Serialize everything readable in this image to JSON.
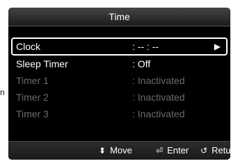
{
  "side_text": "n",
  "dialog": {
    "title": "Time"
  },
  "menu": {
    "items": [
      {
        "label": "Clock",
        "value": ": -- : --",
        "state": "highlighted"
      },
      {
        "label": "Sleep Timer",
        "value": ": Off",
        "state": "active"
      },
      {
        "label": "Timer 1",
        "value": ": Inactivated",
        "state": "inactive"
      },
      {
        "label": "Timer 2",
        "value": ": Inactivated",
        "state": "inactive"
      },
      {
        "label": "Timer 3",
        "value": ": Inactivated",
        "state": "inactive"
      }
    ]
  },
  "footer": {
    "move_label": "Move",
    "enter_label": "Enter",
    "return_label": "Return"
  },
  "icons": {
    "move": "up-down-arrows-icon",
    "enter": "enter-icon",
    "return": "return-icon",
    "submenu": "right-arrow-icon"
  },
  "colors": {
    "screen_bg": "#000000",
    "active_text": "#ffffff",
    "inactive_text": "#6b6b6b"
  }
}
